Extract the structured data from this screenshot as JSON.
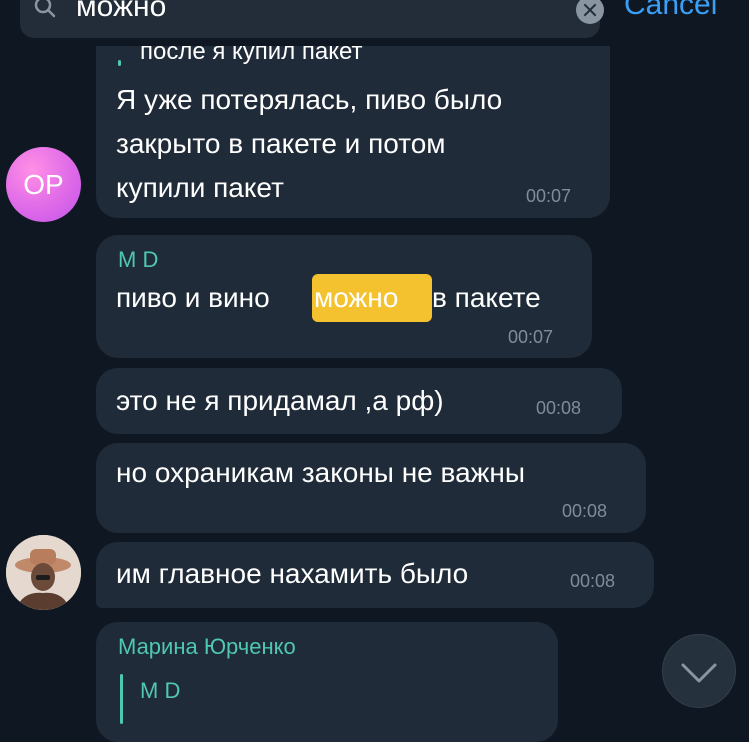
{
  "search": {
    "query": "можно",
    "cancel_label": "Cancel"
  },
  "messages": [
    {
      "reply_text": "после я купил пакет",
      "lines": [
        "Я уже потерялась, пиво было",
        "закрыто в пакете и потом",
        "купили пакет"
      ],
      "time": "00:07"
    },
    {
      "sender": "M D",
      "text_before": "пиво и вино",
      "highlight": "можно",
      "text_after": "в пакете",
      "time": "00:07"
    },
    {
      "text": "это не я придамал ,а рф)",
      "time": "00:08"
    },
    {
      "text": "но охраникам законы не важны",
      "time": "00:08"
    },
    {
      "text": "им главное нахамить было",
      "time": "00:08"
    },
    {
      "sender": "Марина Юрченко",
      "reply_sender": "M D"
    }
  ],
  "avatars": {
    "first_initials": "OP"
  },
  "colors": {
    "background": "#0f1822",
    "bubble": "#1f2b38",
    "accent_name": "#4fc7b1",
    "highlight": "#f4c22f",
    "link": "#3a9ff7"
  },
  "icons": {
    "search": "search-icon",
    "clear": "clear-icon",
    "scroll_down": "chevron-down-icon"
  }
}
